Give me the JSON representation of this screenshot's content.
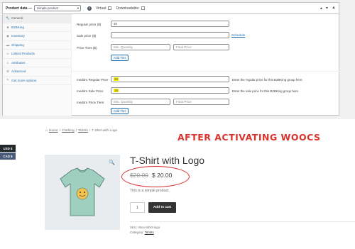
{
  "admin": {
    "header": {
      "title": "Product data —",
      "type_value": "Simple product",
      "help": "?",
      "virtual_label": "Virtual:",
      "downloadable_label": "Downloadable:"
    },
    "sidebar": [
      {
        "label": "General",
        "icon": "wrench-icon",
        "glyph": "🔧",
        "active": true
      },
      {
        "label": "B2BKing",
        "icon": "b2b-icon",
        "glyph": "■",
        "active": false
      },
      {
        "label": "Inventory",
        "icon": "inventory-icon",
        "glyph": "◆",
        "active": false
      },
      {
        "label": "Shipping",
        "icon": "truck-icon",
        "glyph": "▬",
        "active": false
      },
      {
        "label": "Linked Products",
        "icon": "link-icon",
        "glyph": "∞",
        "active": false
      },
      {
        "label": "Attributes",
        "icon": "list-icon",
        "glyph": "≡",
        "active": false
      },
      {
        "label": "Advanced",
        "icon": "gear-icon",
        "glyph": "⚙",
        "active": false
      },
      {
        "label": "Get more options",
        "icon": "plug-icon",
        "glyph": "✎",
        "active": false
      }
    ],
    "fields": {
      "regular_label": "Regular price ($)",
      "regular_value": "20",
      "sale_label": "Sale price ($)",
      "sale_value": "",
      "schedule_link": "Schedule",
      "tiers_label": "Price Tiers ($)",
      "min_qty_placeholder": "Min. Quantity",
      "final_price_placeholder": "Final Price",
      "add_tier": "Add Tier",
      "b2b_regular_label": "meditro Regular Price",
      "b2b_regular_value": "20",
      "b2b_regular_hint": "Enter the regular price for this B2BKing group here.",
      "b2b_sale_label": "meditro Sale Price",
      "b2b_sale_value": "15",
      "b2b_sale_hint": "Enter the sale price for this B2BKing group here.",
      "b2b_tiers_label": "meditro Price Tiers",
      "b2b_min_qty_placeholder": "Min. Quantity",
      "b2b_final_price_placeholder": "Final Price",
      "b2b_add_tier": "Add Tier"
    }
  },
  "store": {
    "breadcrumb": {
      "home": "Home",
      "sep1": "/",
      "clothing": "Clothing",
      "sep2": "/",
      "tshirts": "Tshirts",
      "sep3": "/",
      "current": "T-Shirt with Logo"
    },
    "overlay_title": "AFTER ACTIVATING WOOCS",
    "currencies": [
      "USD $",
      "CAD $"
    ],
    "product": {
      "title": "T-Shirt with Logo",
      "old_price": "$20.00",
      "new_price": "$ 20.00",
      "description": "This is a simple product.",
      "quantity": "1",
      "add_to_cart": "Add to cart",
      "sku_label": "SKU:",
      "sku_value": "Woo-tshirt-logo",
      "category_label": "Category:",
      "category_value": "Tshirts"
    }
  },
  "colors": {
    "link": "#2271b1",
    "highlight": "#fff200",
    "annotation_red": "#d9342b",
    "button_dark": "#333333"
  }
}
